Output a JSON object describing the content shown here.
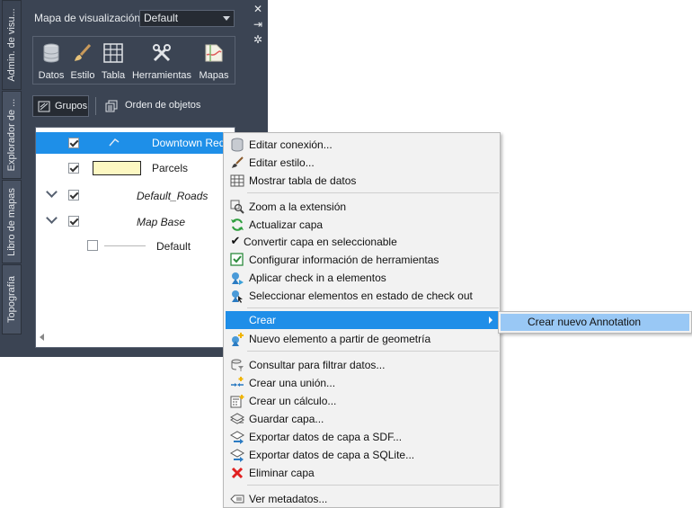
{
  "panel": {
    "vertical_tabs": [
      "Admin. de visu...",
      "Explorador de ...",
      "Libro de mapas",
      "Topografía"
    ],
    "side_icons": [
      "close-icon",
      "pin-icon",
      "settings-icon"
    ],
    "map_label": "Mapa de visualización:",
    "map_select_value": "Default",
    "tools": [
      {
        "label": "Datos",
        "icon": "database-icon"
      },
      {
        "label": "Estilo",
        "icon": "brush-icon"
      },
      {
        "label": "Tabla",
        "icon": "table-icon"
      },
      {
        "label": "Herramientas",
        "icon": "tools-icon"
      },
      {
        "label": "Mapas",
        "icon": "map-icon"
      }
    ],
    "groups_button": "Grupos",
    "draw_order_button": "Orden de objetos",
    "layers": [
      {
        "label": "Downtown Redding",
        "checked": true,
        "selected": true
      },
      {
        "label": "Parcels",
        "checked": true,
        "swatch": "#fdf8c2"
      },
      {
        "label": "Default_Roads",
        "checked": true,
        "group": true
      },
      {
        "label": "Map Base",
        "checked": true,
        "group": true
      },
      {
        "label": "Default",
        "checked": false
      }
    ]
  },
  "context_menu": {
    "items": [
      {
        "label": "Editar conexión...",
        "icon": "database-icon"
      },
      {
        "label": "Editar estilo...",
        "icon": "brush-icon"
      },
      {
        "label": "Mostrar tabla de datos",
        "icon": "table-icon"
      },
      {
        "label": "Zoom a la extensión",
        "icon": "zoom-extents-icon"
      },
      {
        "label": "Actualizar capa",
        "icon": "refresh-icon"
      },
      {
        "label": "Convertir capa en seleccionable",
        "icon": "checkmark-icon"
      },
      {
        "label": "Configurar información de herramientas",
        "icon": "tooltip-config-icon"
      },
      {
        "label": "Aplicar check in a elementos",
        "icon": "check-in-icon"
      },
      {
        "label": "Seleccionar elementos en estado de check out",
        "icon": "check-out-icon"
      },
      {
        "label": "Crear",
        "icon": "",
        "highlighted": true
      },
      {
        "label": "Nuevo elemento a partir de geometría",
        "icon": "new-feature-icon"
      },
      {
        "label": "Consultar para filtrar datos...",
        "icon": "query-icon"
      },
      {
        "label": "Crear una unión...",
        "icon": "join-icon"
      },
      {
        "label": "Crear un cálculo...",
        "icon": "calculator-icon"
      },
      {
        "label": "Guardar capa...",
        "icon": "save-layer-icon"
      },
      {
        "label": "Exportar datos de capa a SDF...",
        "icon": "export-sdf-icon"
      },
      {
        "label": "Exportar datos de capa a SQLite...",
        "icon": "export-sqlite-icon"
      },
      {
        "label": "Eliminar capa",
        "icon": "delete-icon"
      },
      {
        "label": "Ver metadatos...",
        "icon": "metadata-icon"
      }
    ],
    "submenu_item": "Crear nuevo Annotation"
  },
  "colors": {
    "panel_bg": "#3b4453",
    "highlight": "#1f8ee8",
    "submenu_highlight": "#99c8f5",
    "tree_selected": "#1e8fe8"
  }
}
